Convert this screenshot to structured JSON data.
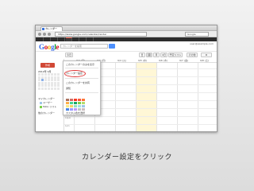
{
  "browser": {
    "tab_title": "カレンダー",
    "url": "https://www.google.com/calendar/render",
    "search_placeholder": "Google"
  },
  "app": {
    "logo": [
      "G",
      "o",
      "o",
      "g",
      "l",
      "e"
    ],
    "search_placeholder": "カレンダーを検索",
    "user": "user@example.com",
    "create_label": "作成",
    "toolbar": [
      "今日",
      "日",
      "週",
      "月",
      "4日",
      "予定リスト",
      "その他"
    ],
    "minical_title": "2012年 9月",
    "my_calendars_label": "マイカレンダー",
    "calendars": [
      {
        "label": "ユーザー",
        "color": "#9fc6e7"
      },
      {
        "label": "ToDo リスト",
        "color": "#7bd148"
      }
    ],
    "other_calendars_label": "他のカレンダー"
  },
  "calendar": {
    "columns": [
      "9/2 (日)",
      "9/3 (月)",
      "9/4 (火)",
      "9/5 (水)",
      "9/6 (木)",
      "9/7 (金)",
      "9/8 (土)"
    ],
    "hours": [
      "6am",
      "7am",
      "8am",
      "9am",
      "10am",
      "11am",
      "12pm",
      "1pm"
    ]
  },
  "menu": {
    "items": [
      "このカレンダーのみを表示",
      "カレンダー設定",
      "このカレンダーを共有",
      "通知",
      "カスタム色を選択"
    ],
    "swatch_colors": [
      "#ac725e",
      "#d06b64",
      "#f83a22",
      "#fa573c",
      "#ff7537",
      "#ffad46",
      "#42d692",
      "#16a765",
      "#7bd148",
      "#b3dc6c",
      "#fbe983",
      "#fad165",
      "#92e1c0",
      "#9fe1e7",
      "#9fc6e7",
      "#4986e7",
      "#9a9cff",
      "#b99aff",
      "#c2c2c2",
      "#cabdbf"
    ]
  },
  "caption": "カレンダー設定をクリック"
}
